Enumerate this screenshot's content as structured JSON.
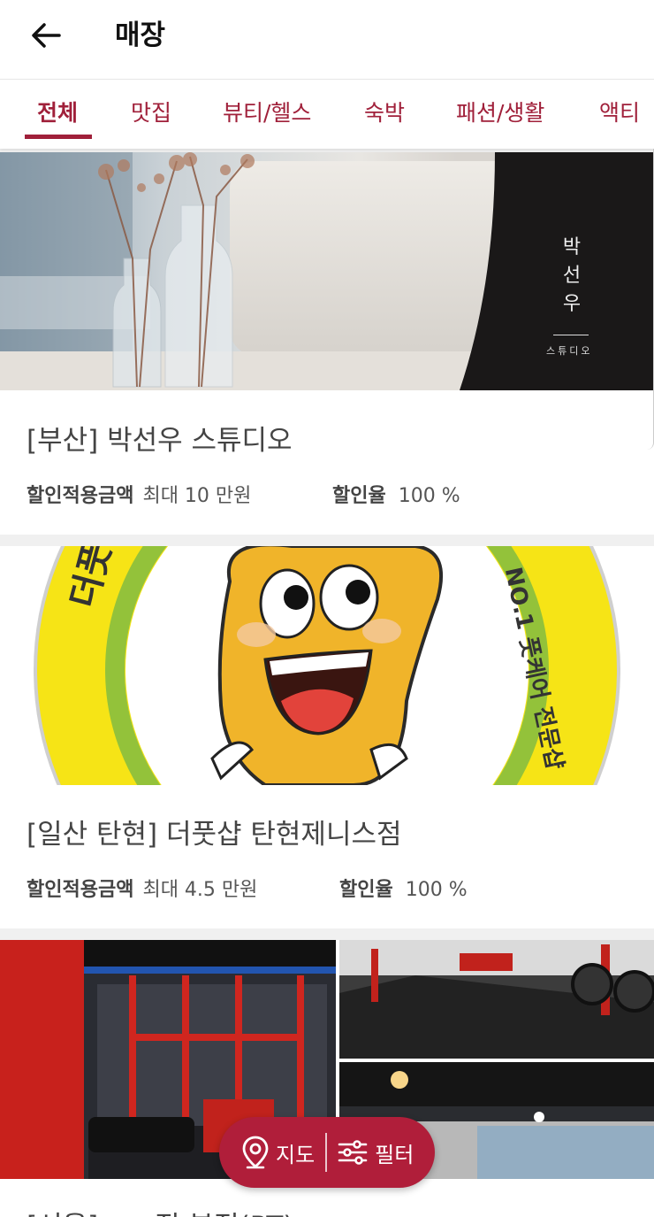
{
  "header": {
    "title": "매장",
    "back_icon": "arrow-left-icon"
  },
  "tabs": [
    {
      "label": "전체",
      "active": true
    },
    {
      "label": "맛집",
      "active": false
    },
    {
      "label": "뷰티/헬스",
      "active": false
    },
    {
      "label": "숙박",
      "active": false
    },
    {
      "label": "패션/생활",
      "active": false
    },
    {
      "label": "액티",
      "active": false
    }
  ],
  "accent_color": "#a0203a",
  "stores": [
    {
      "title": "[부산] 박선우 스튜디오",
      "image_text": {
        "vertical": [
          "박",
          "선",
          "우"
        ],
        "small": "스튜디오"
      },
      "discount_label": "할인적용금액",
      "discount_value": "최대 10 만원",
      "rate_label": "할인율",
      "rate_value": "100 %"
    },
    {
      "title": "[일산 탄현] 더풋샵 탄현제니스점",
      "image_text": {
        "logo_left": "더풋샵",
        "logo_right": "NO.1 풋케어 전문샵"
      },
      "discount_label": "할인적용금액",
      "discount_value": "최대 4.5 만원",
      "rate_label": "할인율",
      "rate_value": "100 %"
    },
    {
      "title": "[서울] ○○짐 본점(PT)"
    }
  ],
  "fab": {
    "map_label": "지도",
    "filter_label": "필터",
    "map_icon": "location-pin-icon",
    "filter_icon": "sliders-icon"
  }
}
